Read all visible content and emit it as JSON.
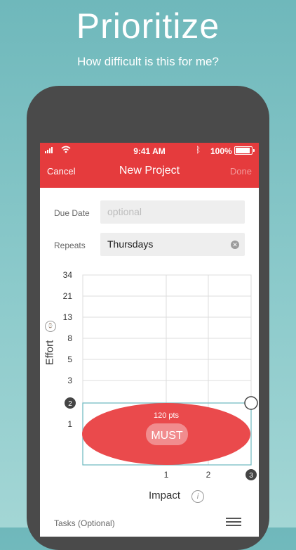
{
  "headline": "Prioritize",
  "subhead": "How difficult is this for me?",
  "status_bar": {
    "time": "9:41 AM",
    "battery": "100%"
  },
  "nav": {
    "cancel": "Cancel",
    "title": "New Project",
    "done": "Done"
  },
  "form": {
    "due_date": {
      "label": "Due Date",
      "placeholder": "optional",
      "value": ""
    },
    "repeats": {
      "label": "Repeats",
      "value": "Thursdays"
    }
  },
  "chart_data": {
    "type": "scatter",
    "y_ticks": [
      "34",
      "21",
      "13",
      "8",
      "5",
      "3",
      "2",
      "1"
    ],
    "x_ticks": [
      "1",
      "2",
      "3"
    ],
    "ylabel": "Effort",
    "xlabel": "Impact",
    "selected_effort": "2",
    "selected_impact": "3",
    "blob": {
      "points_label": "120 pts",
      "priority": "MUST"
    }
  },
  "tasks_label": "Tasks (Optional)",
  "colors": {
    "accent": "#e53b3d",
    "blob": "#ea4a4c",
    "selection": "#6ab8bf",
    "background": "#7dc1c2"
  }
}
